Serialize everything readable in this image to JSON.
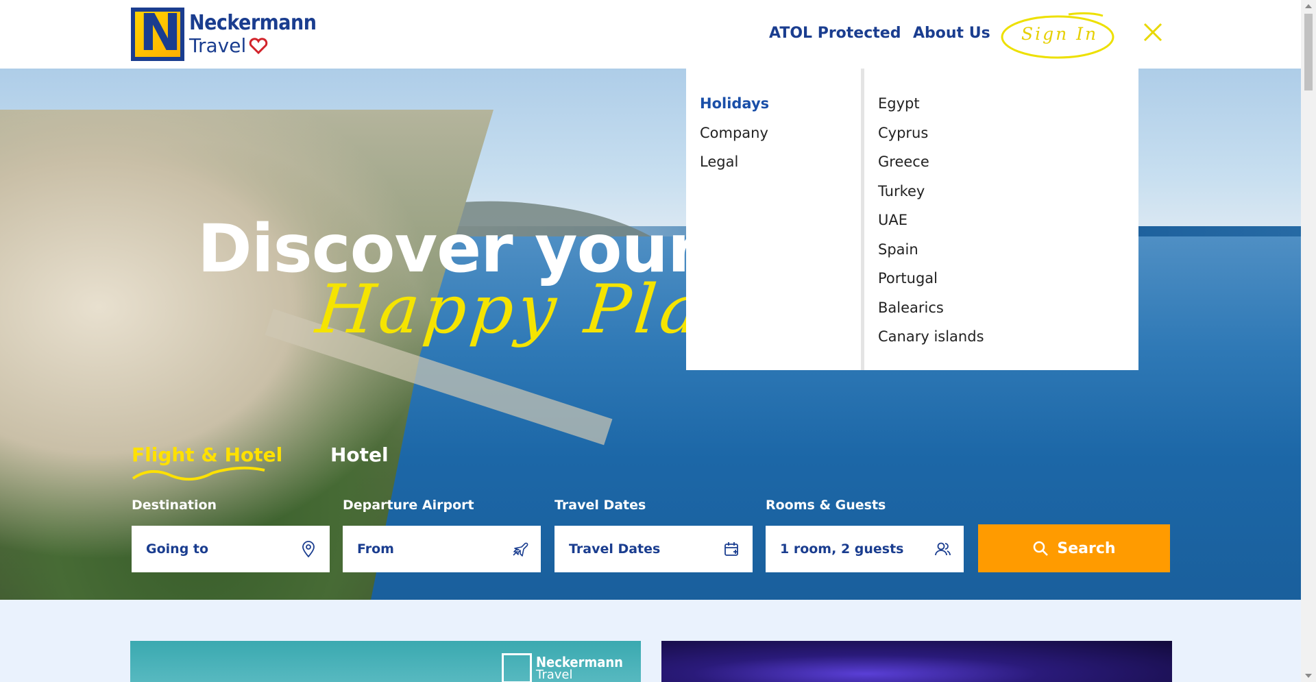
{
  "header": {
    "logo": {
      "line1": "Neckermann",
      "line2": "Travel",
      "icon": "heart-icon"
    },
    "nav": {
      "atol": "ATOL Protected",
      "about": "About Us"
    },
    "sign_in": "Sign In",
    "close_icon": "close-icon"
  },
  "dropdown": {
    "menu": [
      "Holidays",
      "Company",
      "Legal"
    ],
    "active": "Holidays",
    "destinations": [
      "Egypt",
      "Cyprus",
      "Greece",
      "Turkey",
      "UAE",
      "Spain",
      "Portugal",
      "Balearics",
      "Canary islands"
    ]
  },
  "hero": {
    "headline": "Discover your",
    "script": "Happy Plac"
  },
  "search": {
    "tabs": {
      "flight_hotel": "Flight & Hotel",
      "hotel": "Hotel"
    },
    "labels": {
      "destination": "Destination",
      "departure": "Departure Airport",
      "dates": "Travel Dates",
      "rooms": "Rooms & Guests"
    },
    "values": {
      "destination": "Going to",
      "departure": "From",
      "dates": "Travel Dates",
      "rooms": "1 room, 2 guests"
    },
    "button": "Search"
  },
  "cards": {
    "card1_logo": {
      "line1": "Neckermann",
      "line2": "Travel"
    }
  },
  "colors": {
    "brand_blue": "#1a3d8f",
    "accent_yellow": "#ffe100",
    "search_orange": "#ff9b00",
    "page_bg": "#eaf2fd"
  }
}
